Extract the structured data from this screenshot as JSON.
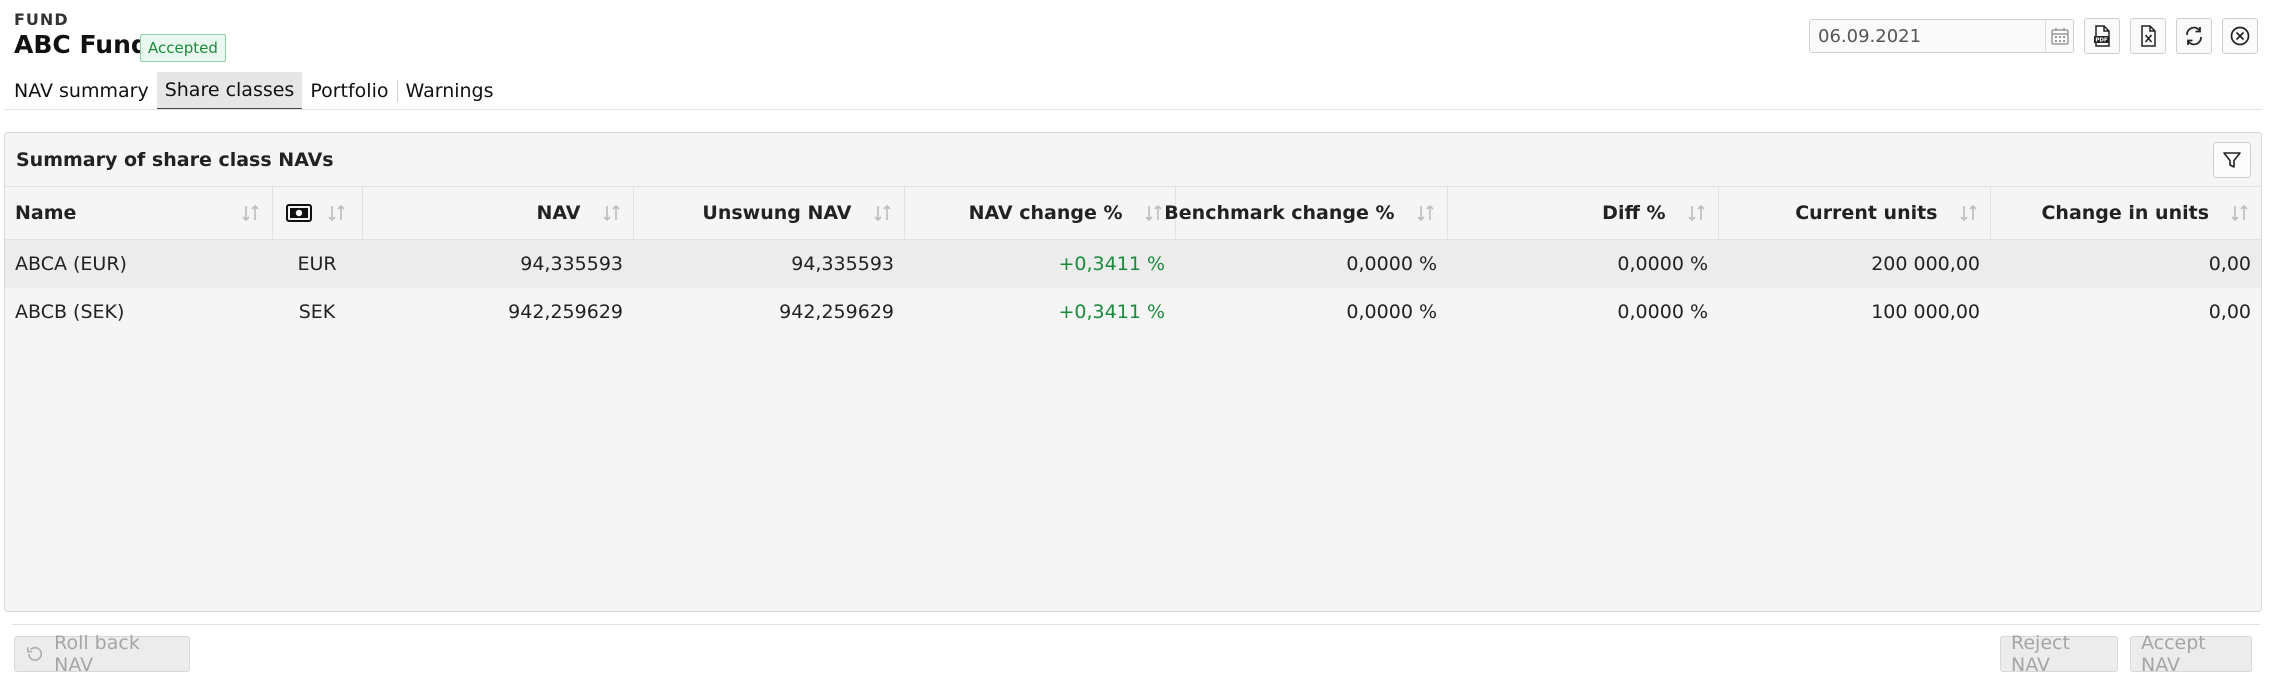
{
  "header": {
    "label": "FUND",
    "title": "ABC Fund",
    "status": "Accepted"
  },
  "toolbar": {
    "date": "06.09.2021",
    "icons": [
      "calendar-icon",
      "pdf-icon",
      "excel-icon",
      "refresh-icon",
      "close-icon"
    ]
  },
  "tabs": [
    {
      "label": "NAV summary"
    },
    {
      "label": "Share classes",
      "active": true
    },
    {
      "label": "Portfolio"
    },
    {
      "label": "Warnings"
    }
  ],
  "panel": {
    "title": "Summary of share class NAVs",
    "columns": {
      "name": "Name",
      "nav": "NAV",
      "unswung": "Unswung NAV",
      "nav_change": "NAV change %",
      "bench_change": "Benchmark change %",
      "diff": "Diff %",
      "units": "Current units",
      "change_units": "Change in units"
    },
    "rows": [
      {
        "name": "ABCA (EUR)",
        "currency": "EUR",
        "nav": "94,335593",
        "unswung": "94,335593",
        "nav_change": "+0,3411 %",
        "bench_change": "0,0000 %",
        "diff": "0,0000 %",
        "units": "200 000,00",
        "change_units": "0,00"
      },
      {
        "name": "ABCB (SEK)",
        "currency": "SEK",
        "nav": "942,259629",
        "unswung": "942,259629",
        "nav_change": "+0,3411 %",
        "bench_change": "0,0000 %",
        "diff": "0,0000 %",
        "units": "100 000,00",
        "change_units": "0,00"
      }
    ]
  },
  "footer": {
    "rollback": "Roll back NAV",
    "reject": "Reject NAV",
    "accept": "Accept NAV"
  },
  "colors": {
    "accent_green": "#1a8a3c",
    "badge_bg": "#eaf7ee"
  }
}
